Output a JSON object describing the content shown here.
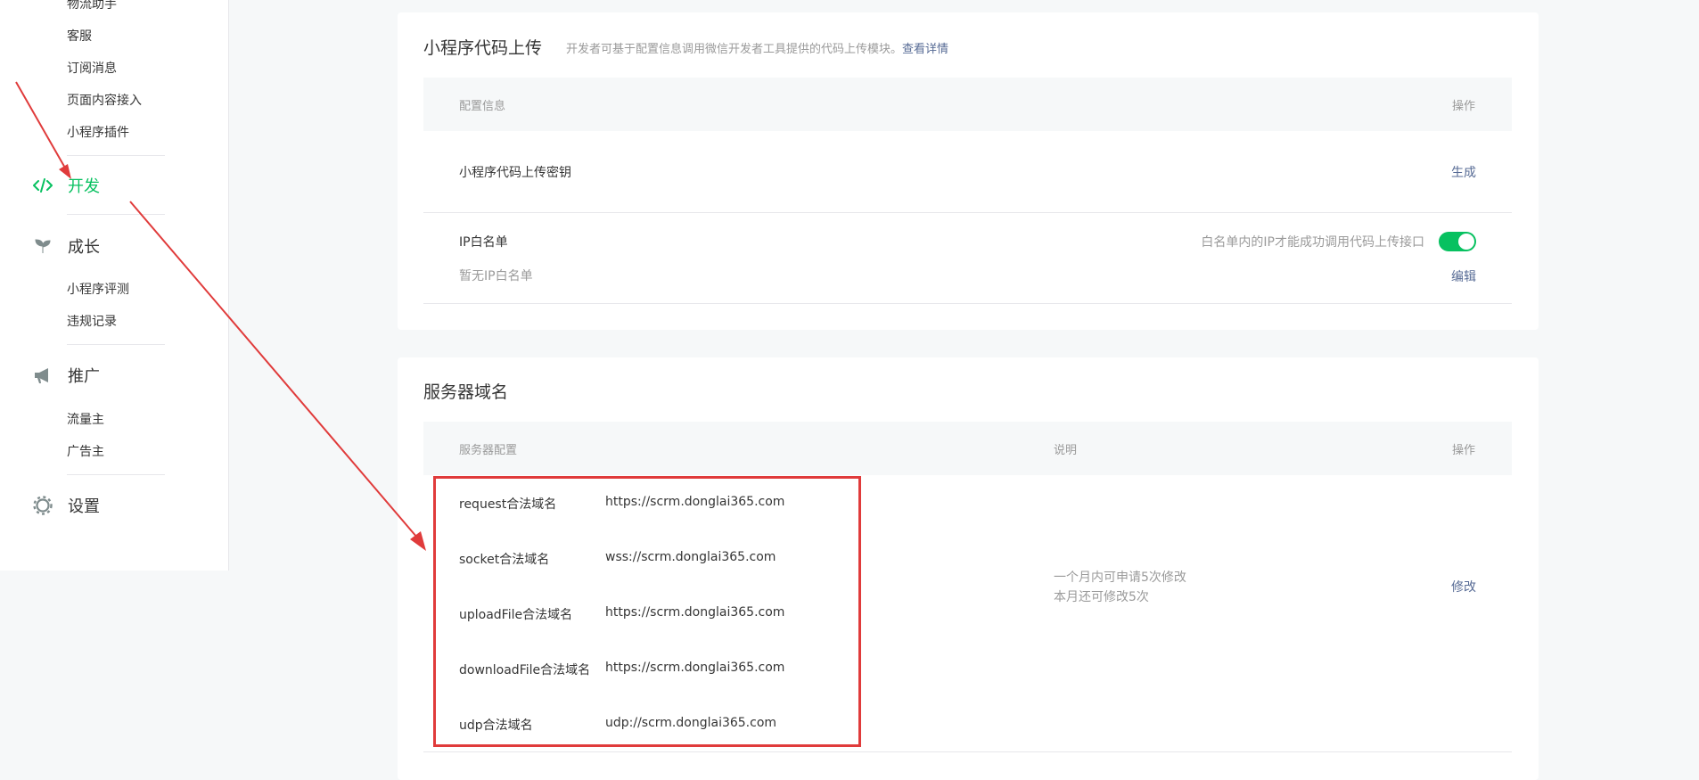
{
  "sidebar": {
    "sub_top": [
      "物流助手",
      "客服",
      "订阅消息",
      "页面内容接入",
      "小程序插件"
    ],
    "dev_label": "开发",
    "growth_label": "成长",
    "growth_items": [
      "小程序评测",
      "违规记录"
    ],
    "promo_label": "推广",
    "promo_items": [
      "流量主",
      "广告主"
    ],
    "settings_label": "设置"
  },
  "upload_card": {
    "title": "小程序代码上传",
    "desc": "开发者可基于配置信息调用微信开发者工具提供的代码上传模块。",
    "desc_link": "查看详情",
    "col_config": "配置信息",
    "col_action": "操作",
    "secret_label": "小程序代码上传密钥",
    "secret_action": "生成",
    "ip_label": "IP白名单",
    "ip_empty": "暂无IP白名单",
    "ip_hint": "白名单内的IP才能成功调用代码上传接口",
    "ip_action": "编辑"
  },
  "server_card": {
    "title": "服务器域名",
    "col_config": "服务器配置",
    "col_desc": "说明",
    "col_action": "操作",
    "domains": [
      {
        "label": "request合法域名",
        "value": "https://scrm.donglai365.com"
      },
      {
        "label": "socket合法域名",
        "value": "wss://scrm.donglai365.com"
      },
      {
        "label": "uploadFile合法域名",
        "value": "https://scrm.donglai365.com"
      },
      {
        "label": "downloadFile合法域名",
        "value": "https://scrm.donglai365.com"
      },
      {
        "label": "udp合法域名",
        "value": "udp://scrm.donglai365.com"
      }
    ],
    "desc_line1": "一个月内可申请5次修改",
    "desc_line2": "本月还可修改5次",
    "action": "修改"
  },
  "colors": {
    "accent": "#07c160",
    "link": "#576b95",
    "annotation": "#e03b3b"
  }
}
